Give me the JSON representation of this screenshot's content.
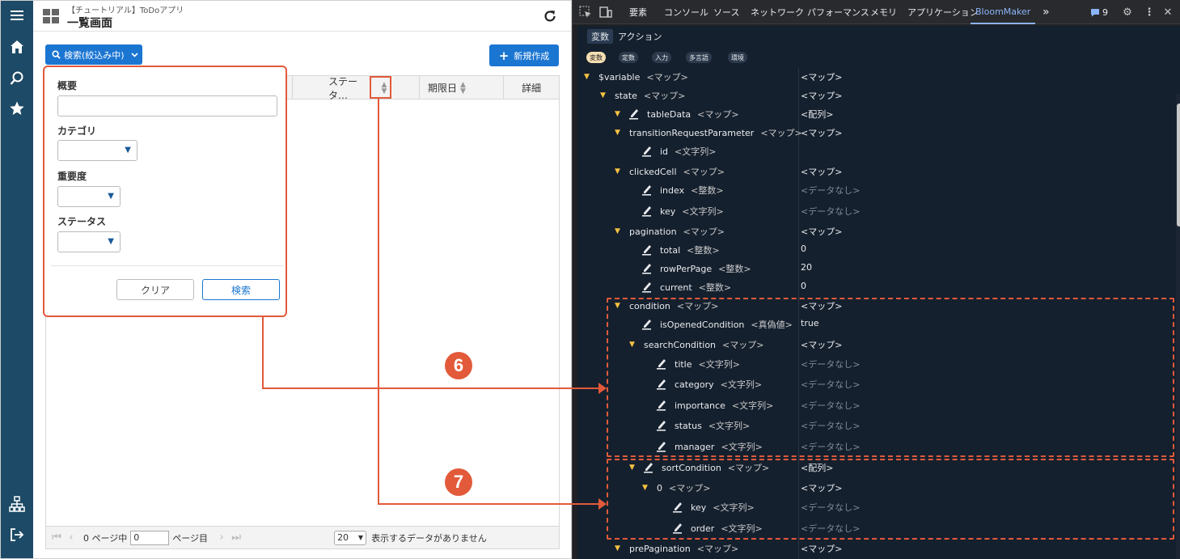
{
  "app": {
    "header": {
      "subtitle": "【チュートリアル】ToDoアプリ",
      "title": "一覧画面"
    },
    "search_button": {
      "label": "検索(絞込み中)"
    },
    "new_button": {
      "label": "新規作成"
    },
    "table": {
      "columns": [
        {
          "label": "ステータ…",
          "sortable": true
        },
        {
          "label": "期限日",
          "sortable": true
        },
        {
          "label": "詳細",
          "sortable": false
        }
      ]
    },
    "pager": {
      "page_text": "0 ページ中",
      "page_value": "0",
      "page_suffix": "ページ目",
      "rows_per_page": "20",
      "status": "表示するデータがありません"
    },
    "filter_popup": {
      "fields": [
        {
          "label": "概要",
          "type": "text",
          "value": ""
        },
        {
          "label": "カテゴリ",
          "type": "select",
          "value": ""
        },
        {
          "label": "重要度",
          "type": "select",
          "value": ""
        },
        {
          "label": "ステータス",
          "type": "select",
          "value": ""
        }
      ],
      "clear_label": "クリア",
      "search_label": "検索"
    },
    "sidebar_icons": [
      "menu-icon",
      "home-icon",
      "search-icon",
      "star-icon",
      "sitemap-icon",
      "logout-icon"
    ]
  },
  "devtools": {
    "tabs": [
      "要素",
      "コンソール",
      "ソース",
      "ネットワーク",
      "パフォーマンス",
      "メモリ",
      "アプリケーション",
      "BloomMaker"
    ],
    "active_tab": "BloomMaker",
    "overflow": "»",
    "issues_count": "9",
    "bloommaker": {
      "tabs": [
        "変数",
        "アクション"
      ],
      "active_tab": "変数",
      "chips": [
        "変数",
        "定数",
        "入力",
        "多言語",
        "環境"
      ],
      "active_chip": "変数",
      "tree": [
        {
          "key": "$variable",
          "type": "<マップ>",
          "value": "<マップ>",
          "expanded": true,
          "editable": false,
          "depth": 0
        },
        {
          "key": "state",
          "type": "<マップ>",
          "value": "<マップ>",
          "expanded": true,
          "editable": false,
          "depth": 1
        },
        {
          "key": "tableData",
          "type": "<マップ>",
          "value": "<配列>",
          "expanded": true,
          "editable": true,
          "depth": 2
        },
        {
          "key": "transitionRequestParameter",
          "type": "<マップ>",
          "value": "<マップ>",
          "expanded": true,
          "editable": false,
          "depth": 2
        },
        {
          "key": "id",
          "type": "<文字列>",
          "value": "",
          "expanded": false,
          "editable": true,
          "depth": 3
        },
        {
          "key": "clickedCell",
          "type": "<マップ>",
          "value": "<マップ>",
          "expanded": true,
          "editable": false,
          "depth": 2
        },
        {
          "key": "index",
          "type": "<整数>",
          "value": "<データなし>",
          "expanded": false,
          "editable": true,
          "depth": 3
        },
        {
          "key": "key",
          "type": "<文字列>",
          "value": "<データなし>",
          "expanded": false,
          "editable": true,
          "depth": 3
        },
        {
          "key": "pagination",
          "type": "<マップ>",
          "value": "<マップ>",
          "expanded": true,
          "editable": false,
          "depth": 2
        },
        {
          "key": "total",
          "type": "<整数>",
          "value": "0",
          "expanded": false,
          "editable": true,
          "depth": 3
        },
        {
          "key": "rowPerPage",
          "type": "<整数>",
          "value": "20",
          "expanded": false,
          "editable": true,
          "depth": 3
        },
        {
          "key": "current",
          "type": "<整数>",
          "value": "0",
          "expanded": false,
          "editable": true,
          "depth": 3
        },
        {
          "key": "condition",
          "type": "<マップ>",
          "value": "<マップ>",
          "expanded": true,
          "editable": false,
          "depth": 2
        },
        {
          "key": "isOpenedCondition",
          "type": "<真偽値>",
          "value": "true",
          "expanded": false,
          "editable": true,
          "depth": 3
        },
        {
          "key": "searchCondition",
          "type": "<マップ>",
          "value": "<マップ>",
          "expanded": true,
          "editable": false,
          "depth": 3
        },
        {
          "key": "title",
          "type": "<文字列>",
          "value": "<データなし>",
          "expanded": false,
          "editable": true,
          "depth": 4
        },
        {
          "key": "category",
          "type": "<文字列>",
          "value": "<データなし>",
          "expanded": false,
          "editable": true,
          "depth": 4
        },
        {
          "key": "importance",
          "type": "<文字列>",
          "value": "<データなし>",
          "expanded": false,
          "editable": true,
          "depth": 4
        },
        {
          "key": "status",
          "type": "<文字列>",
          "value": "<データなし>",
          "expanded": false,
          "editable": true,
          "depth": 4
        },
        {
          "key": "manager",
          "type": "<文字列>",
          "value": "<データなし>",
          "expanded": false,
          "editable": true,
          "depth": 4
        },
        {
          "key": "sortCondition",
          "type": "<マップ>",
          "value": "<配列>",
          "expanded": true,
          "editable": true,
          "depth": 3
        },
        {
          "key": "0",
          "type": "<マップ>",
          "value": "<マップ>",
          "expanded": true,
          "editable": false,
          "depth": 4
        },
        {
          "key": "key",
          "type": "<文字列>",
          "value": "<データなし>",
          "expanded": false,
          "editable": true,
          "depth": 5
        },
        {
          "key": "order",
          "type": "<文字列>",
          "value": "<データなし>",
          "expanded": false,
          "editable": true,
          "depth": 5
        },
        {
          "key": "prePagination",
          "type": "<マップ>",
          "value": "<マップ>",
          "expanded": true,
          "editable": false,
          "depth": 2
        }
      ]
    }
  },
  "annotations": [
    {
      "label": "6",
      "color": "#e25a3a"
    },
    {
      "label": "7",
      "color": "#e25a3a"
    }
  ],
  "colors": {
    "accent": "#1b76d2",
    "annotation": "#e25a3a",
    "sidebar": "#1d4a66",
    "devtools_bg": "#15202e"
  }
}
